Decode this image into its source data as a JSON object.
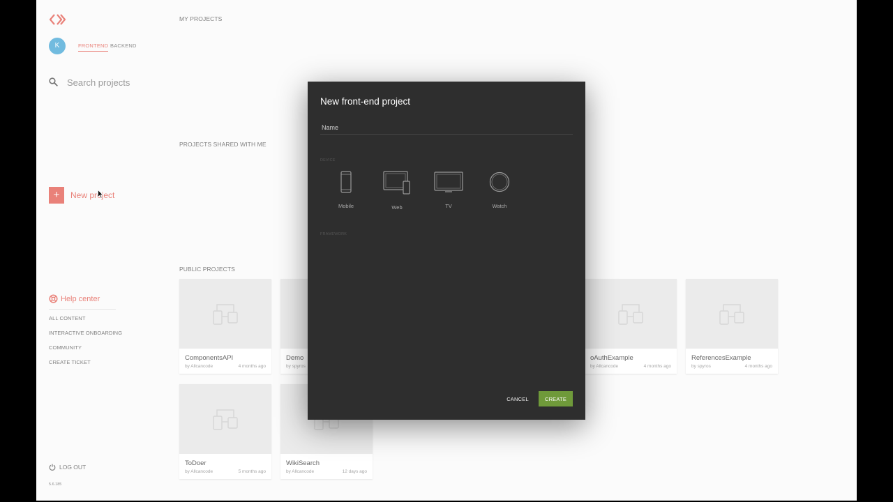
{
  "colors": {
    "accent": "#e2574c",
    "avatar": "#42a5d5",
    "create": "#6f9a3a"
  },
  "sidebar": {
    "avatar_initial": "K",
    "tabs": [
      "FRONTEND",
      "BACKEND"
    ],
    "search_placeholder": "Search projects",
    "new_project_label": "New project",
    "help_center_label": "Help center",
    "help_links": [
      "ALL CONTENT",
      "INTERACTIVE ONBOARDING",
      "COMMUNITY",
      "CREATE TICKET"
    ],
    "logout_label": "LOG OUT",
    "version": "5.6.185"
  },
  "main": {
    "my_projects_title": "MY PROJECTS",
    "shared_title": "PROJECTS SHARED WITH ME",
    "public_title": "PUBLIC PROJECTS",
    "public_projects": [
      {
        "name": "ComponentsAPI",
        "author": "by Allcancode",
        "date": "4 months ago"
      },
      {
        "name": "Demo",
        "author": "by spyros",
        "date": ""
      },
      {
        "name": "oAuthExample",
        "author": "by Allcancode",
        "date": "4 months ago"
      },
      {
        "name": "ReferencesExample",
        "author": "by spyros",
        "date": "4 months ago"
      },
      {
        "name": "ToDoer",
        "author": "by Allcancode",
        "date": "5 months ago"
      },
      {
        "name": "WikiSearch",
        "author": "by Allcancode",
        "date": "12 days ago"
      }
    ]
  },
  "modal": {
    "title": "New front-end project",
    "name_placeholder": "Name",
    "device_section": "DEVICE",
    "framework_section": "FRAMEWORK",
    "devices": [
      {
        "label": "Mobile",
        "icon": "mobile-icon"
      },
      {
        "label": "Web",
        "icon": "web-icon"
      },
      {
        "label": "TV",
        "icon": "tv-icon"
      },
      {
        "label": "Watch",
        "icon": "watch-icon"
      }
    ],
    "cancel_label": "CANCEL",
    "create_label": "CREATE"
  }
}
